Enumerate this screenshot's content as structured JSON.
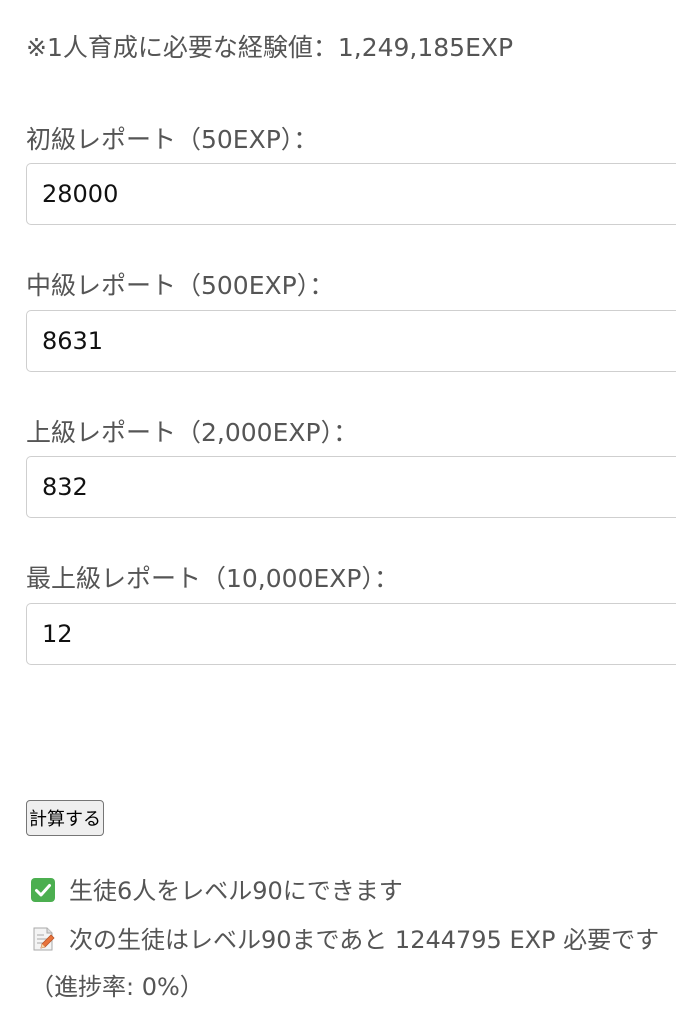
{
  "note": "※1人育成に必要な経験値：1,249,185EXP",
  "fields": [
    {
      "label": "初級レポート（50EXP）：",
      "value": "28000"
    },
    {
      "label": "中級レポート（500EXP）：",
      "value": "8631"
    },
    {
      "label": "上級レポート（2,000EXP）：",
      "value": "832"
    },
    {
      "label": "最上級レポート（10,000EXP）：",
      "value": "12"
    }
  ],
  "calc_button_label": "計算する",
  "results": {
    "students_line": "生徒6人をレベル90にできます",
    "students_icon": "check-mark-icon",
    "next_line": "次の生徒はレベル90まであと 1244795 EXP 必要です",
    "next_icon": "memo-icon",
    "progress": "（進捗率: 0%）"
  }
}
